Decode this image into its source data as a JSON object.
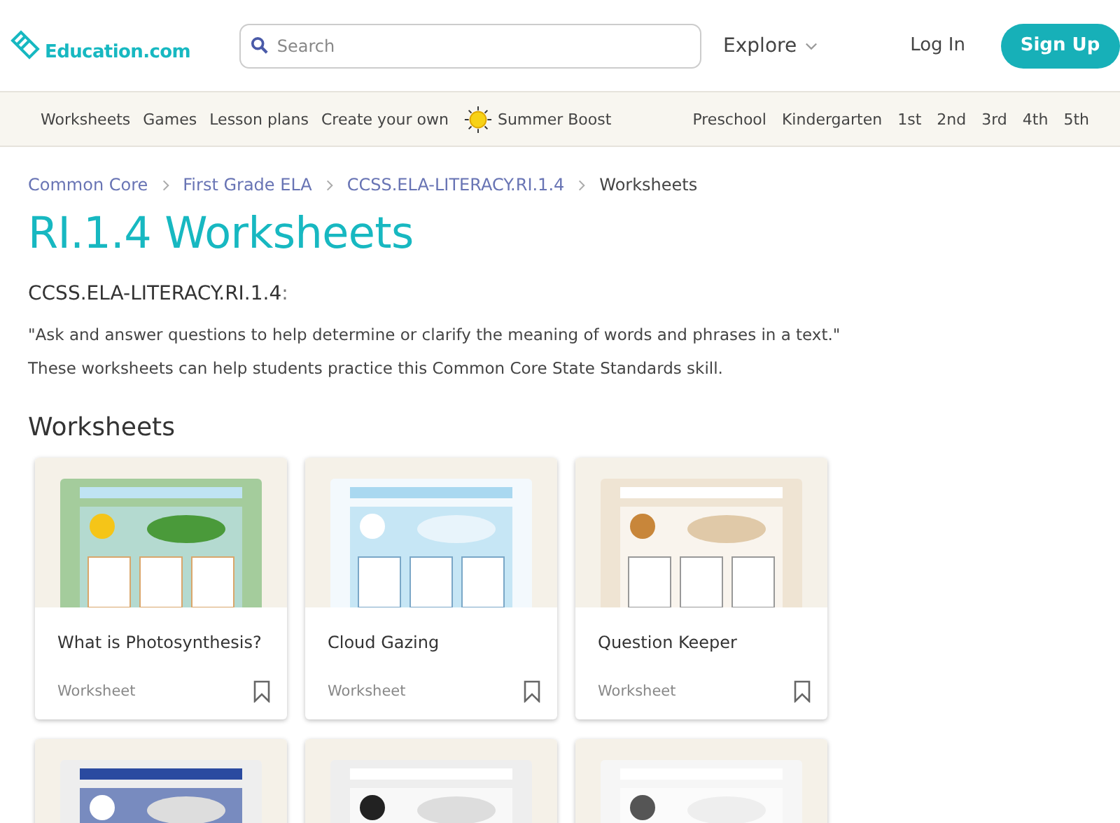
{
  "header": {
    "logo": "Education.com",
    "search": {
      "placeholder": "Search"
    },
    "explore": "Explore",
    "login": "Log In",
    "signup": "Sign Up"
  },
  "nav": {
    "left": [
      {
        "label": "Worksheets",
        "kind": "link"
      },
      {
        "label": "Games",
        "kind": "link"
      },
      {
        "label": "Lesson plans",
        "kind": "link"
      },
      {
        "label": "Create your own",
        "kind": "link"
      },
      {
        "label": "Summer Boost",
        "kind": "sun"
      }
    ],
    "grades": [
      "Preschool",
      "Kindergarten",
      "1st",
      "2nd",
      "3rd",
      "4th",
      "5th"
    ]
  },
  "breadcrumb": [
    {
      "label": "Common Core",
      "kind": "link"
    },
    {
      "label": "First Grade ELA",
      "kind": "link"
    },
    {
      "label": "CCSS.ELA-LITERACY.RI.1.4",
      "kind": "link"
    },
    {
      "label": "Worksheets",
      "kind": "current"
    }
  ],
  "title": "RI.1.4 Worksheets",
  "standard": {
    "code": "CCSS.ELA-LITERACY.RI.1.4",
    "code_suffix": ":",
    "quote": "\"Ask and answer questions to help determine or clarify the meaning of words and phrases in a text.\"",
    "description": "These worksheets can help students practice this Common Core State Standards skill."
  },
  "section_title": "Worksheets",
  "worksheets": [
    {
      "kind": "picture",
      "title": "What is Photosynthesis?",
      "type": "Worksheet"
    },
    {
      "kind": "picture",
      "title": "Cloud Gazing",
      "type": "Worksheet"
    },
    {
      "kind": "picture",
      "title": "Question Keeper",
      "type": "Worksheet"
    },
    {
      "kind": "picture"
    },
    {
      "kind": "picture"
    },
    {
      "kind": "picture"
    }
  ]
}
